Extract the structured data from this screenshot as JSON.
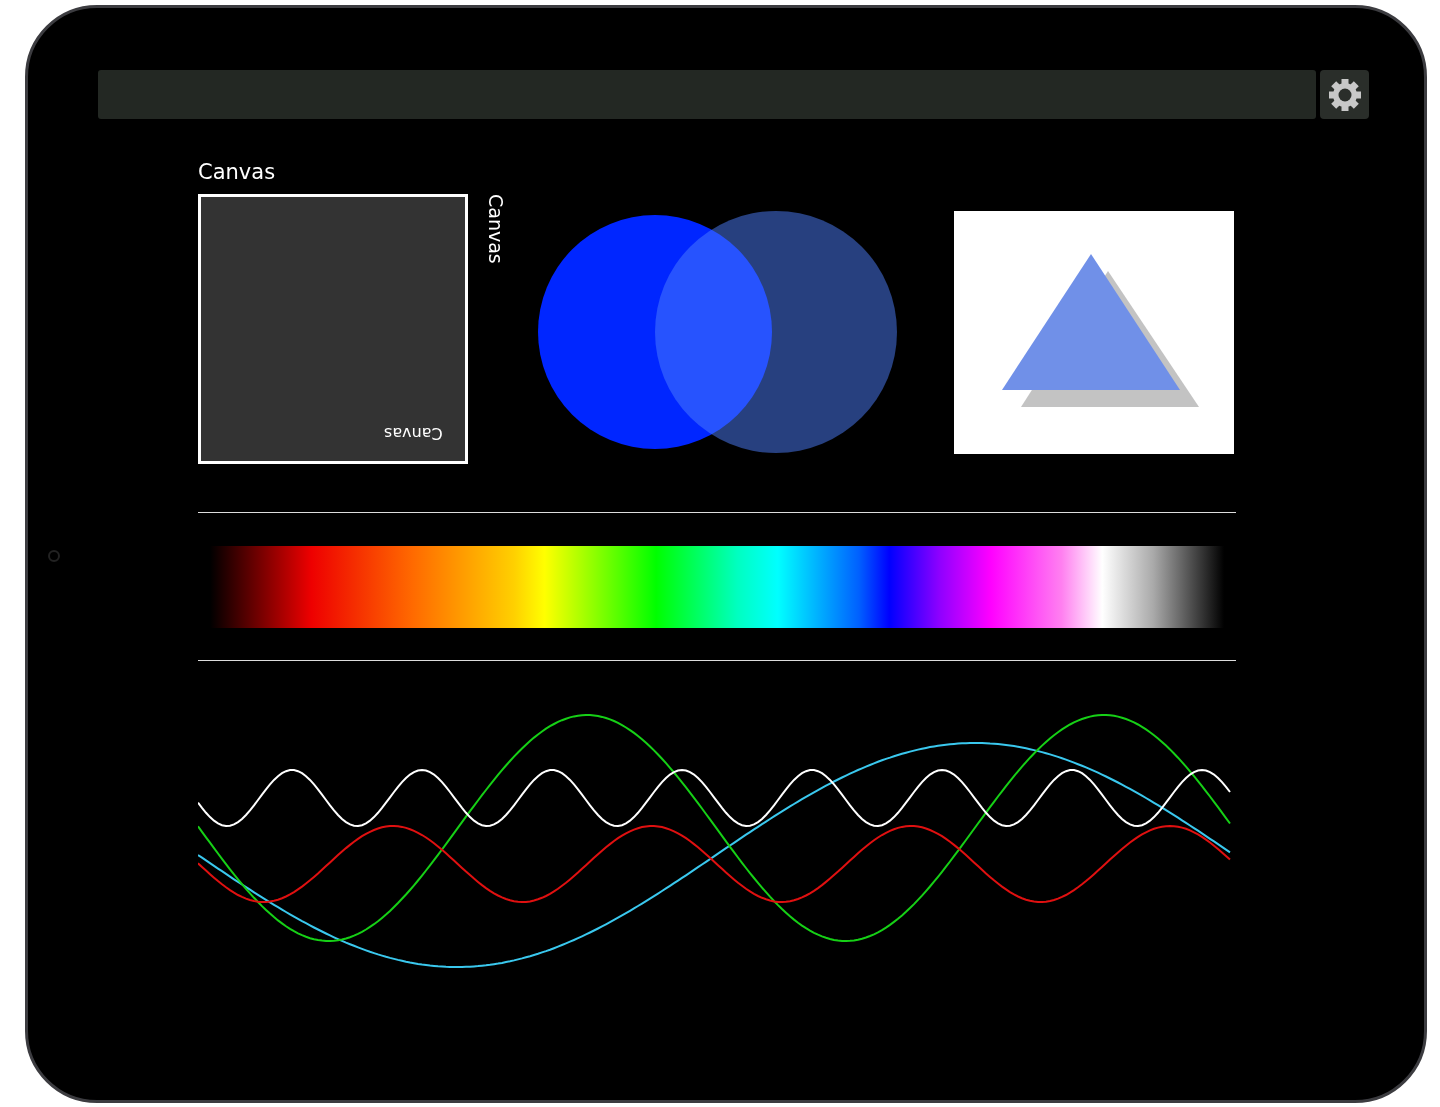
{
  "screen": {
    "heading": "Canvas",
    "canvas_box": {
      "caption": "Canvas"
    },
    "side_caption": "Canvas"
  }
}
